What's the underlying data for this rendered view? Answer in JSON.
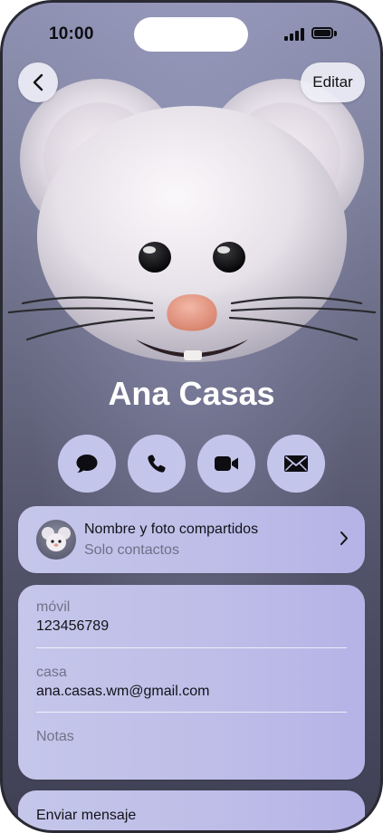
{
  "status_bar": {
    "time": "10:00"
  },
  "top_bar": {
    "back_icon": "chevron-left-icon",
    "edit_label": "Editar"
  },
  "contact": {
    "name": "Ana Casas",
    "photo": "mouse-memoji"
  },
  "actions": [
    {
      "icon": "message-icon"
    },
    {
      "icon": "phone-icon"
    },
    {
      "icon": "video-icon"
    },
    {
      "icon": "mail-icon"
    }
  ],
  "share_card": {
    "title": "Nombre y foto compartidos",
    "subtitle": "Solo contactos"
  },
  "fields": {
    "mobile_label": "móvil",
    "mobile_value": "123456789",
    "home_label": "casa",
    "home_value": "ana.casas.wm@gmail.com",
    "notes_label": "Notas"
  },
  "send_message": "Enviar mensaje",
  "colors": {
    "background_top": "#8f92b3",
    "background_bottom": "#3f3f54",
    "card": "#c5c6ea",
    "action_button": "#c4c5ea"
  }
}
